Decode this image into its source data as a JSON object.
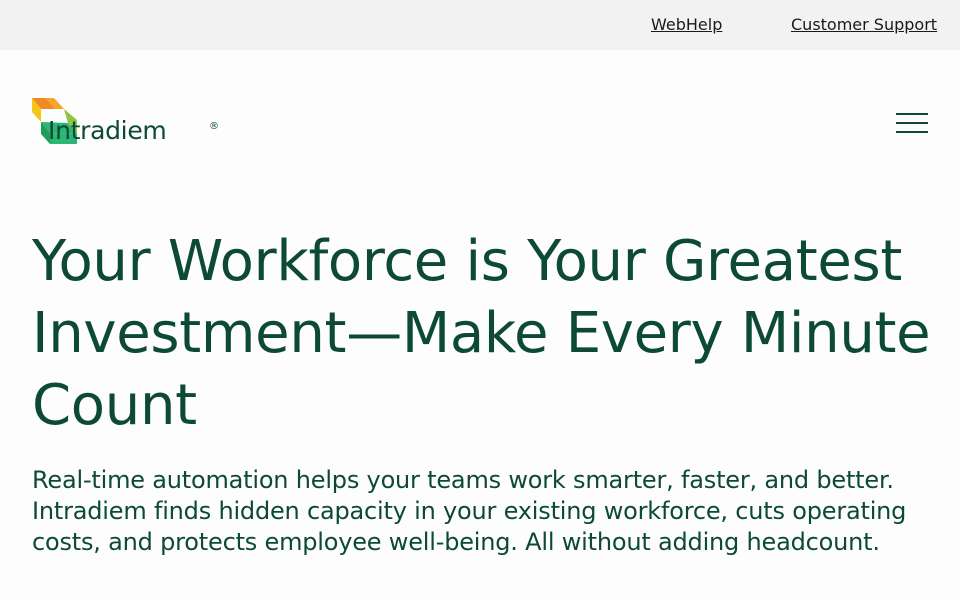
{
  "topbar": {
    "links": [
      {
        "label": "WebHelp"
      },
      {
        "label": "Customer Support"
      }
    ]
  },
  "header": {
    "logo_text": "Intradiem",
    "logo_mark": "®",
    "menu_icon": "hamburger-menu-icon"
  },
  "hero": {
    "headline": "Your Workforce is Your Greatest Investment—Make Every Minute Count",
    "subtext": "Real-time automation helps your teams work smarter, faster, and better. Intradiem finds hidden capacity in your existing workforce, cuts operating costs, and protects employee well-being. All without adding headcount."
  },
  "colors": {
    "brand_green": "#0c4a35",
    "logo_orange": "#f08a24",
    "logo_yellow": "#f5c518",
    "logo_green": "#2bb673",
    "logo_lime": "#8dc63f",
    "topbar_bg": "#f2f2f2"
  }
}
